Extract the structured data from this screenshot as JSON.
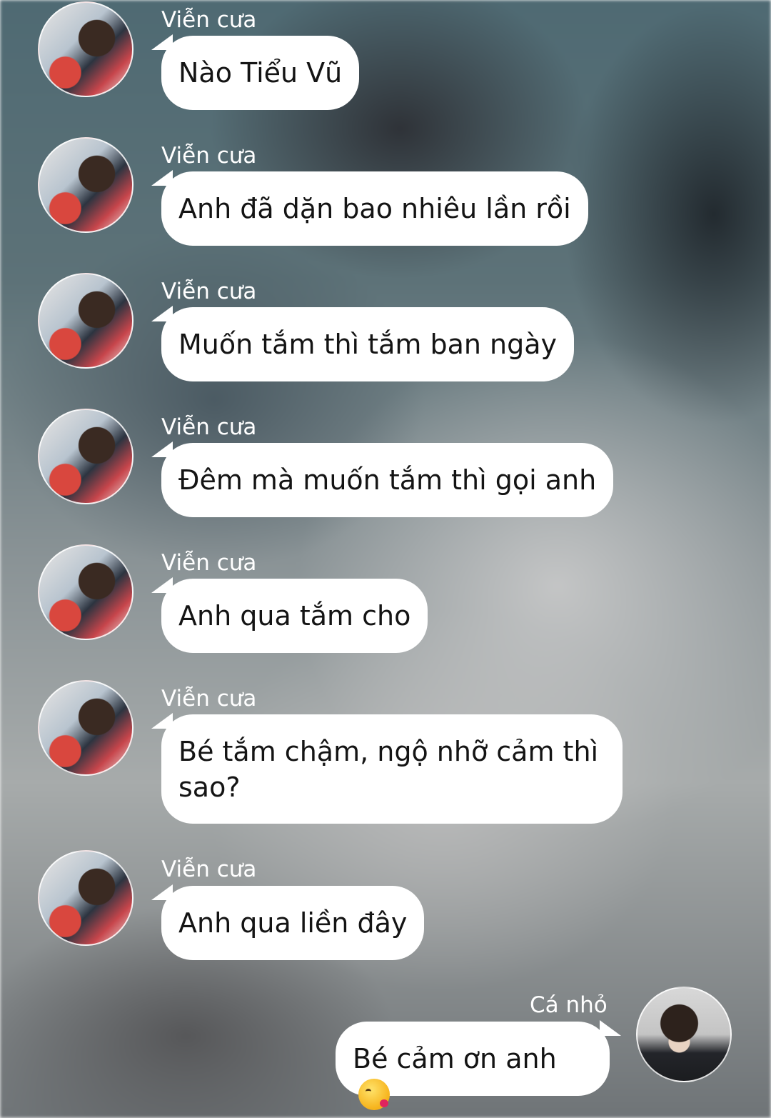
{
  "messages": [
    {
      "sender": "Viễn cưa",
      "text": "Nào Tiểu Vũ",
      "side": "left"
    },
    {
      "sender": "Viễn cưa",
      "text": "Anh đã dặn bao nhiêu lần rồi",
      "side": "left"
    },
    {
      "sender": "Viễn cưa",
      "text": "Muốn tắm thì tắm ban ngày",
      "side": "left"
    },
    {
      "sender": "Viễn cưa",
      "text": "Đêm mà muốn tắm thì gọi anh",
      "side": "left"
    },
    {
      "sender": "Viễn cưa",
      "text": "Anh qua tắm cho",
      "side": "left"
    },
    {
      "sender": "Viễn cưa",
      "text": "Bé tắm chậm, ngộ nhỡ cảm thì sao?",
      "side": "left"
    },
    {
      "sender": "Viễn cưa",
      "text": "Anh qua liền đây",
      "side": "left"
    },
    {
      "sender": "Cá nhỏ",
      "text": "Bé cảm ơn anh",
      "side": "right",
      "emoji": "kissing-face-with-heart-emoji"
    }
  ],
  "colors": {
    "bubble": "#ffffff",
    "text": "#141414",
    "sender_name": "#ffffff"
  }
}
